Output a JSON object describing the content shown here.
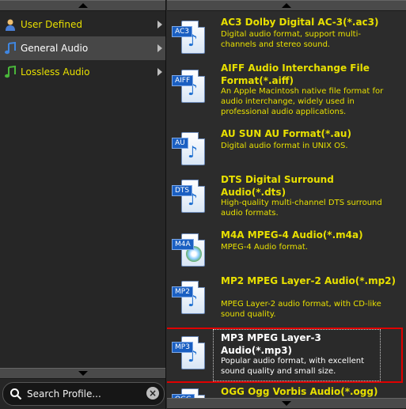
{
  "categories": [
    {
      "label": "User Defined",
      "icon": "user-icon"
    },
    {
      "label": "General Audio",
      "icon": "music-note-icon"
    },
    {
      "label": "Lossless Audio",
      "icon": "green-music-note-icon"
    }
  ],
  "search": {
    "placeholder": "Search Profile..."
  },
  "formats": [
    {
      "tag": "AC3",
      "title": "AC3 Dolby Digital AC-3(*.ac3)",
      "desc": "Digital audio format, support multi-channels and stereo sound."
    },
    {
      "tag": "AIFF",
      "title": "AIFF Audio Interchange File Format(*.aiff)",
      "desc": "An Apple Macintosh native file format for audio interchange, widely used in professional audio applications."
    },
    {
      "tag": "AU",
      "title": "AU SUN AU Format(*.au)",
      "desc": "Digital audio format in UNIX OS."
    },
    {
      "tag": "DTS",
      "title": "DTS Digital Surround Audio(*.dts)",
      "desc": "High-quality multi-channel DTS surround audio formats."
    },
    {
      "tag": "M4A",
      "title": "M4A MPEG-4 Audio(*.m4a)",
      "desc": "MPEG-4 Audio format."
    },
    {
      "tag": "MP2",
      "title": "MP2 MPEG Layer-2 Audio(*.mp2)",
      "desc": "MPEG Layer-2 audio format, with CD-like sound quality."
    },
    {
      "tag": "MP3",
      "title": "MP3 MPEG Layer-3 Audio(*.mp3)",
      "desc": "Popular audio format, with excellent sound quality and small size."
    },
    {
      "tag": "OGG",
      "title": "OGG Ogg Vorbis Audio(*.ogg)",
      "desc": ""
    }
  ],
  "colors": {
    "accent_text": "#e8e000",
    "selection_border": "#e00000",
    "tag_blue": "#1a5fc2"
  }
}
